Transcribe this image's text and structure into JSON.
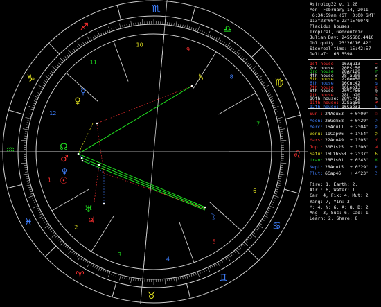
{
  "header": [
    "Astrolog32 v. 1.20",
    "Mon. February 14, 2011",
    " 6:34:59am (ST +0:00 GMT)",
    "113°23'00\"E 23°15'00\"N",
    "Placidus houses.",
    "Tropical, Geocentric.",
    "Julian Day: 2455606.4410",
    "Obliquity: 23°26'16.42\"",
    "Sidereal time: 15:42:57",
    "DeltaT:  66.5598"
  ],
  "houses": [
    {
      "label": "1st house:",
      "value": "16Aqu13",
      "glyph": "♒",
      "color": "#ff3030"
    },
    {
      "label": "2nd house:",
      "value": "20Psc56",
      "glyph": "♓",
      "color": "#f0f0f0"
    },
    {
      "label": "3rd house:",
      "value": "28Ari20",
      "glyph": "♈",
      "color": "#20e020"
    },
    {
      "label": "4th house:",
      "value": "28Tau00",
      "glyph": "♉",
      "color": "#f0f0f0"
    },
    {
      "label": "5th house:",
      "value": "22Gem50",
      "glyph": "♊",
      "color": "#e0e020"
    },
    {
      "label": "6th house:",
      "value": "16Cnc42",
      "glyph": "♋",
      "color": "#4080ff"
    },
    {
      "label": "7th house:",
      "value": "16Leo13",
      "glyph": "♌",
      "color": "#ff3030"
    },
    {
      "label": "8th house:",
      "value": "20Vir56",
      "glyph": "♍",
      "color": "#f0f0f0"
    },
    {
      "label": "9th house:",
      "value": "28Lib20",
      "glyph": "♎",
      "color": "#ff3030"
    },
    {
      "label": "10th house:",
      "value": "28Vir42",
      "glyph": "♍",
      "color": "#f0f0f0"
    },
    {
      "label": "11th house:",
      "value": "22Sag50",
      "glyph": "♐",
      "color": "#ff3030"
    },
    {
      "label": "12th house:",
      "value": "16Cap31",
      "glyph": "♑",
      "color": "#4080ff"
    }
  ],
  "planets": [
    {
      "name": "Sun :",
      "pos": "24Aqu53",
      "speed": "+ 0°00'",
      "glyph": "☉",
      "color": "#ff3030"
    },
    {
      "name": "Moon:",
      "pos": "26Gem58",
      "speed": "+ 0°29'",
      "glyph": "☽",
      "color": "#4080ff"
    },
    {
      "name": "Merc:",
      "pos": "16Aqu11",
      "speed": "+ 2°04'",
      "glyph": "☿",
      "color": "#4080ff"
    },
    {
      "name": "Venu:",
      "pos": "11Cap06",
      "speed": "+ 1°54'",
      "glyph": "♀",
      "color": "#e0e020"
    },
    {
      "name": "Mars:",
      "pos": "22Aqu49",
      "speed": "+ 1°05'",
      "glyph": "♂",
      "color": "#ff3030"
    },
    {
      "name": "Jupi:",
      "pos": "30Pis25",
      "speed": "+ 1°00'",
      "glyph": "♃",
      "color": "#ff3030"
    },
    {
      "name": "Satu:",
      "pos": "16Lib55R",
      "speed": "+ 2°37'",
      "glyph": "♄",
      "color": "#e0e020"
    },
    {
      "name": "Uran:",
      "pos": "28Pis01",
      "speed": "+ 0°43'",
      "glyph": "♅",
      "color": "#20e020"
    },
    {
      "name": "Nept:",
      "pos": "28Aqu15",
      "speed": "+ 0°29'",
      "glyph": "♆",
      "color": "#4080ff"
    },
    {
      "name": "Plut:",
      "pos": "6Cap46",
      "speed": "+ 4°23'",
      "glyph": "♇",
      "color": "#4080ff"
    }
  ],
  "stats": [
    "Fire: 1, Earth: 2,",
    "Air : 6, Water: 1",
    "Car: 4, Fix: 4, Mut: 2",
    "Yang: 7, Yin: 3",
    "M: 4, N: 6, A: 8, D: 2",
    "Ang: 3, Suc: 6, Cad: 1",
    "Learn: 2, Share: 8"
  ],
  "wheel": {
    "signs": [
      {
        "glyph": "♒",
        "color": "#20e020"
      },
      {
        "glyph": "♓",
        "color": "#4080ff"
      },
      {
        "glyph": "♈",
        "color": "#ff3030"
      },
      {
        "glyph": "♉",
        "color": "#e0e020"
      },
      {
        "glyph": "♊",
        "color": "#4080ff"
      },
      {
        "glyph": "♋",
        "color": "#4080ff"
      },
      {
        "glyph": "♌",
        "color": "#ff3030"
      },
      {
        "glyph": "♍",
        "color": "#e0e020"
      },
      {
        "glyph": "♎",
        "color": "#20e020"
      },
      {
        "glyph": "♏",
        "color": "#4080ff"
      },
      {
        "glyph": "♐",
        "color": "#ff3030"
      },
      {
        "glyph": "♑",
        "color": "#e0e020"
      }
    ],
    "house_numbers": [
      {
        "n": "1",
        "color": "#ff3030"
      },
      {
        "n": "2",
        "color": "#e0e020"
      },
      {
        "n": "3",
        "color": "#20e020"
      },
      {
        "n": "4",
        "color": "#4080ff"
      },
      {
        "n": "5",
        "color": "#ff3030"
      },
      {
        "n": "6",
        "color": "#e0e020"
      },
      {
        "n": "7",
        "color": "#20e020"
      },
      {
        "n": "8",
        "color": "#4080ff"
      },
      {
        "n": "9",
        "color": "#ff3030"
      },
      {
        "n": "10",
        "color": "#e0e020"
      },
      {
        "n": "11",
        "color": "#20e020"
      },
      {
        "n": "12",
        "color": "#4080ff"
      }
    ],
    "planet_glyphs": [
      {
        "g": "♄",
        "color": "#e0e020"
      },
      {
        "g": "☿",
        "color": "#4080ff"
      },
      {
        "g": "♀",
        "color": "#e0e020"
      },
      {
        "g": "♂",
        "color": "#ff3030"
      },
      {
        "g": "☉",
        "color": "#ff3030"
      },
      {
        "g": "♆",
        "color": "#4080ff"
      },
      {
        "g": "♅",
        "color": "#20e020"
      },
      {
        "g": "♃",
        "color": "#ff3030"
      },
      {
        "g": "☊",
        "color": "#20e020"
      },
      {
        "g": "☽",
        "color": "#4080ff"
      }
    ]
  }
}
